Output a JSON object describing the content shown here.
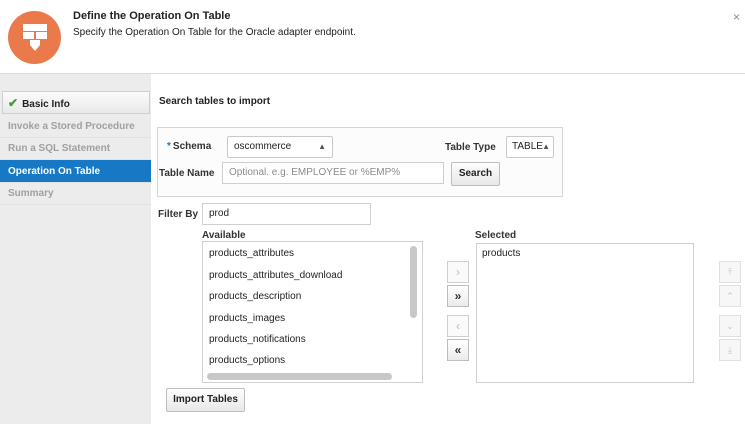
{
  "header": {
    "title": "Define the Operation On Table",
    "subtitle": "Specify the Operation On Table for the Oracle adapter endpoint.",
    "close": "×",
    "icon": "table-operation-icon",
    "icon_color": "#ea7a4b"
  },
  "nav": {
    "items": [
      {
        "label": "Basic Info",
        "state": "completed"
      },
      {
        "label": "Invoke a Stored Procedure",
        "state": "disabled"
      },
      {
        "label": "Run a SQL Statement",
        "state": "disabled"
      },
      {
        "label": "Operation On Table",
        "state": "active"
      },
      {
        "label": "Summary",
        "state": "disabled"
      }
    ],
    "active_color": "#1778c6"
  },
  "main": {
    "title": "Search tables to import",
    "schema_label": "Schema",
    "required_mark": "*",
    "schema_value": "oscommerce",
    "table_type_label": "Table Type",
    "table_type_value": "TABLE",
    "table_name_label": "Table Name",
    "table_name_placeholder": "Optional. e.g. EMPLOYEE or %EMP%",
    "search_button": "Search",
    "filter_label": "Filter By",
    "filter_value": "prod",
    "available_label": "Available",
    "selected_label": "Selected",
    "available_items": [
      "products_attributes",
      "products_attributes_download",
      "products_description",
      "products_images",
      "products_notifications",
      "products_options"
    ],
    "selected_items": [
      "products"
    ],
    "shuttle": {
      "move": "›",
      "move_all": "»",
      "remove": "‹",
      "remove_all": "«"
    },
    "reorder": {
      "top": "⤒",
      "up": "⌃",
      "down": "⌄",
      "bottom": "⤓"
    },
    "import_button": "Import Tables"
  }
}
